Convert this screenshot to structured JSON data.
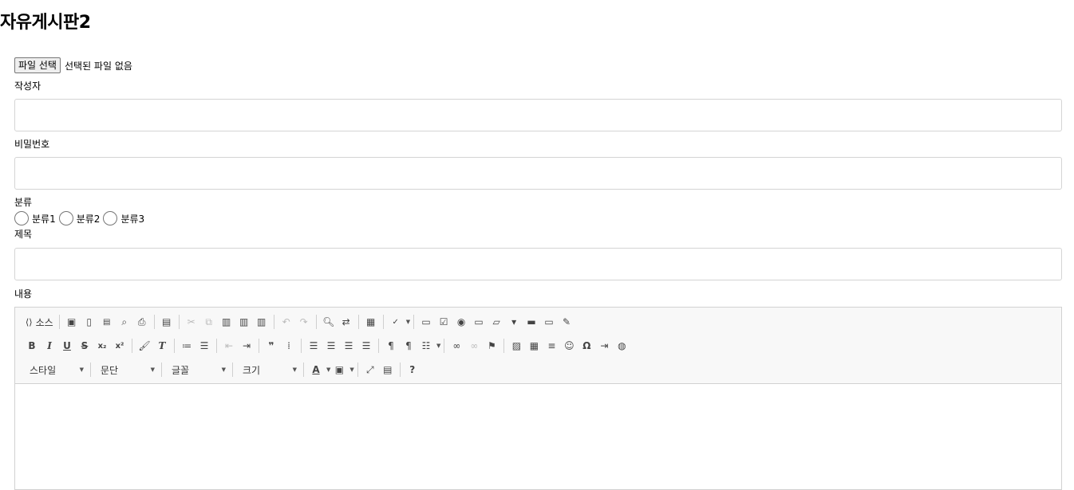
{
  "page": {
    "title": "자유게시판2"
  },
  "file": {
    "button_label": "파일 선택",
    "status": "선택된 파일 없음"
  },
  "fields": {
    "author_label": "작성자",
    "password_label": "비밀번호",
    "category_label": "분류",
    "categories": [
      "분류1",
      "분류2",
      "분류3"
    ],
    "subject_label": "제목",
    "content_label": "내용"
  },
  "editor": {
    "source_label": "소스",
    "combos": {
      "style": "스타일",
      "format": "문단",
      "font": "글꼴",
      "size": "크기"
    }
  }
}
